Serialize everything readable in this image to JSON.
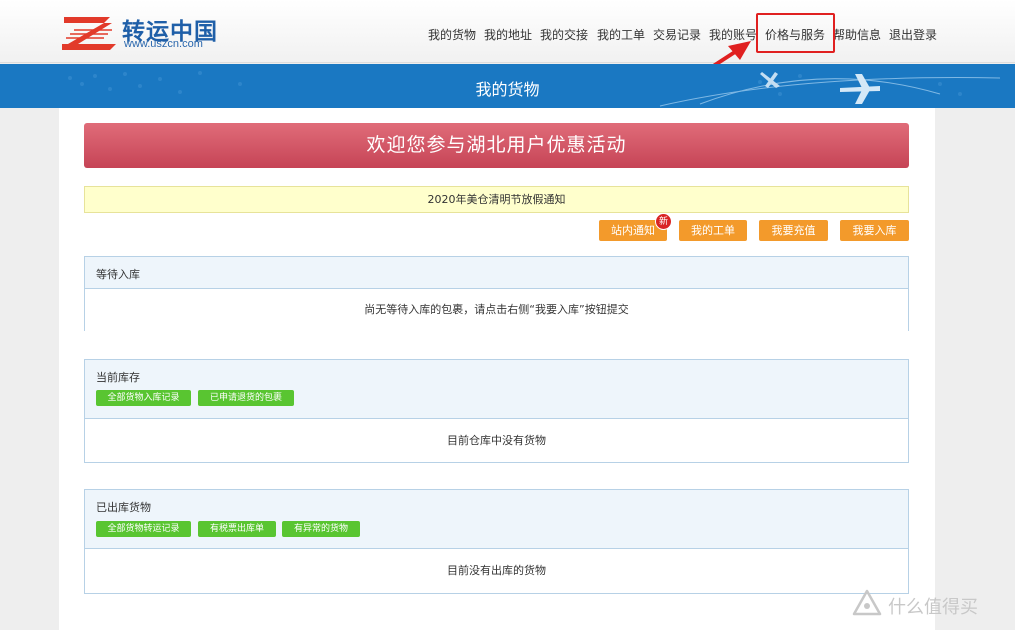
{
  "site": {
    "name": "转运中国",
    "url": "www.uszcn.com"
  },
  "nav": {
    "items": [
      "我的货物",
      "我的地址",
      "我的交接",
      "我的工单",
      "交易记录",
      "我的账号",
      "价格与服务",
      "帮助信息",
      "退出登录"
    ]
  },
  "banner": {
    "title": "我的货物"
  },
  "promo": {
    "text": "欢迎您参与湖北用户优惠活动"
  },
  "notice": {
    "text": "2020年美仓清明节放假通知"
  },
  "actions": {
    "inbox": "站内通知",
    "inbox_badge": "新",
    "tickets": "我的工单",
    "recharge": "我要充值",
    "checkin": "我要入库"
  },
  "panels": {
    "pending": {
      "title": "等待入库",
      "empty": "尚无等待入库的包裹，请点击右侧“我要入库”按钮提交"
    },
    "stock": {
      "title": "当前库存",
      "btn1": "全部货物入库记录",
      "btn2": "已申请退货的包裹",
      "empty": "目前仓库中没有货物"
    },
    "shipped": {
      "title": "已出库货物",
      "btn1": "全部货物转运记录",
      "btn2": "有税票出库单",
      "btn3": "有异常的货物",
      "empty": "目前没有出库的货物"
    }
  },
  "watermark": {
    "text": "什么值得买"
  },
  "colors": {
    "brand_blue": "#1a78c2",
    "promo_red": "#c64456",
    "orange": "#f39a2b",
    "green": "#59c531",
    "highlight": "#e02020"
  }
}
